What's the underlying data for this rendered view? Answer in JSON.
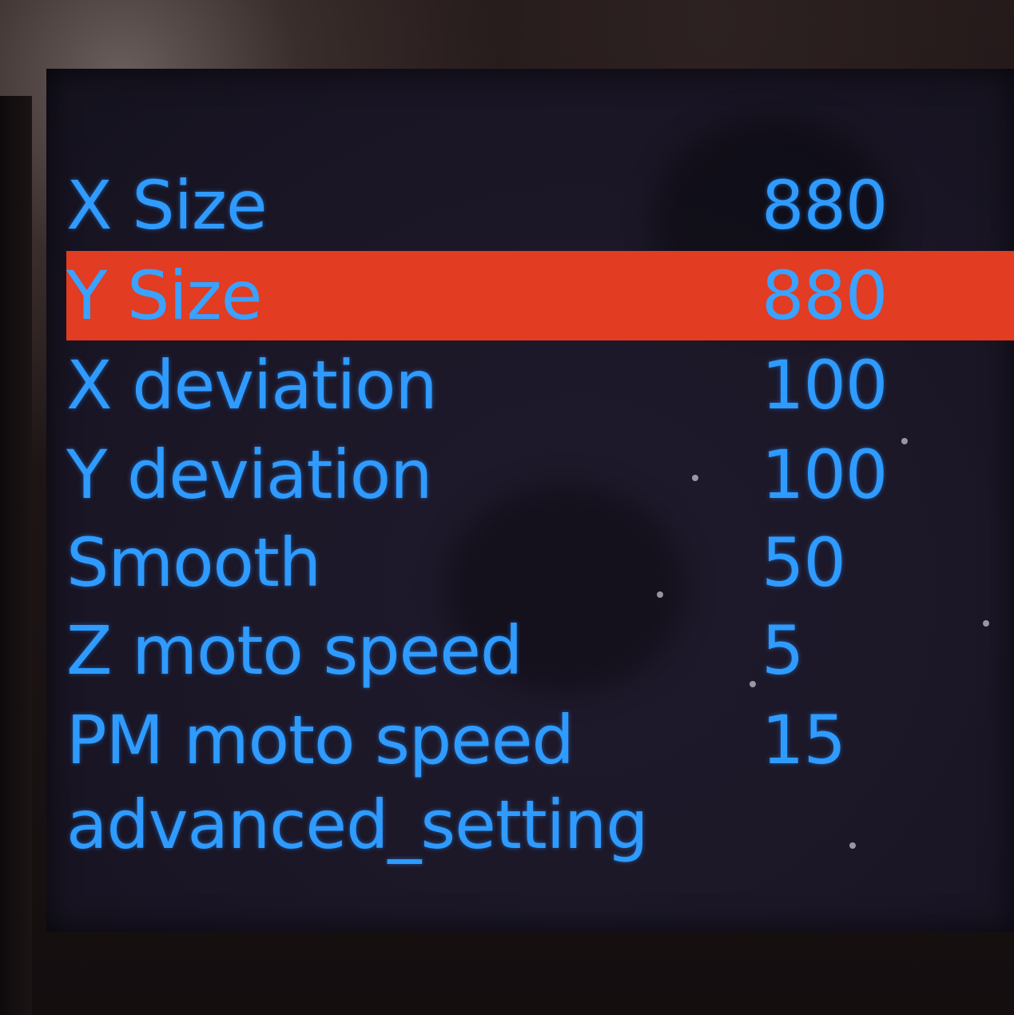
{
  "menu": {
    "items": [
      {
        "label": "X Size",
        "value": "880",
        "selected": false
      },
      {
        "label": "Y Size",
        "value": "880",
        "selected": true
      },
      {
        "label": "X deviation",
        "value": "100",
        "selected": false
      },
      {
        "label": "Y deviation",
        "value": "100",
        "selected": false
      },
      {
        "label": "Smooth",
        "value": "50",
        "selected": false
      },
      {
        "label": "Z moto speed",
        "value": "5",
        "selected": false
      },
      {
        "label": "PM moto speed",
        "value": "15",
        "selected": false
      },
      {
        "label": "advanced_setting",
        "value": "",
        "selected": false
      }
    ]
  },
  "colors": {
    "text": "#2f9bff",
    "highlight": "#e23c22",
    "screen_background": "#1c1828"
  }
}
